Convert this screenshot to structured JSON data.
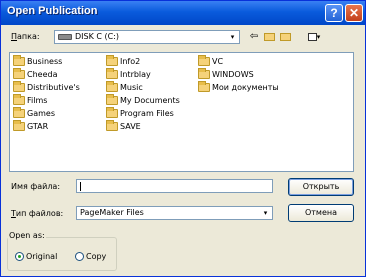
{
  "window": {
    "title": "Open Publication",
    "help_label": "?",
    "close_label": "✕"
  },
  "location": {
    "label_prefix": "П",
    "label_rest": "апка:",
    "drive_icon": "drive-icon",
    "value": "DISK C (C:)"
  },
  "toolbar": {
    "back_icon": "back-arrow-icon",
    "up_icon": "folder-up-icon",
    "new_folder_icon": "new-folder-icon",
    "view_menu_icon": "view-menu-icon"
  },
  "files": {
    "col1": [
      "Business",
      "Cheeda",
      "Distributive's",
      "Films",
      "Games",
      "GTAR"
    ],
    "col2": [
      "Info2",
      "Intrblay",
      "Music",
      "My Documents",
      "Program Files",
      "SAVE"
    ],
    "col3": [
      "VC",
      "WINDOWS",
      "Мои документы"
    ]
  },
  "filename": {
    "label": "Имя файла:",
    "value": ""
  },
  "filetype": {
    "label_prefix": "Т",
    "label_rest": "ип файлов:",
    "value": "PageMaker Files"
  },
  "buttons": {
    "open": "Открыть",
    "cancel": "Отмена"
  },
  "open_as": {
    "title": "Open as:",
    "original": "Original",
    "copy": "Copy",
    "selected": "Original"
  }
}
